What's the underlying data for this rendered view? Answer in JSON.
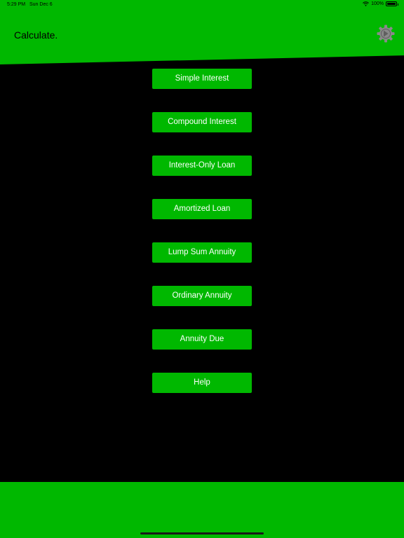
{
  "status_bar": {
    "time": "5:29 PM",
    "date": "Sun Dec 6",
    "battery": "100%"
  },
  "header": {
    "title": "Calculate."
  },
  "icons": {
    "settings": "gear-icon",
    "wifi": "wifi-icon",
    "battery": "battery-icon"
  },
  "menu": {
    "items": [
      {
        "label": "Simple Interest"
      },
      {
        "label": "Compound Interest"
      },
      {
        "label": "Interest-Only Loan"
      },
      {
        "label": "Amortized Loan"
      },
      {
        "label": "Lump Sum Annuity"
      },
      {
        "label": "Ordinary Annuity"
      },
      {
        "label": "Annuity Due"
      },
      {
        "label": "Help"
      }
    ]
  },
  "colors": {
    "brand_green": "#00b800",
    "background": "#000000",
    "button_text": "#ffffff"
  }
}
